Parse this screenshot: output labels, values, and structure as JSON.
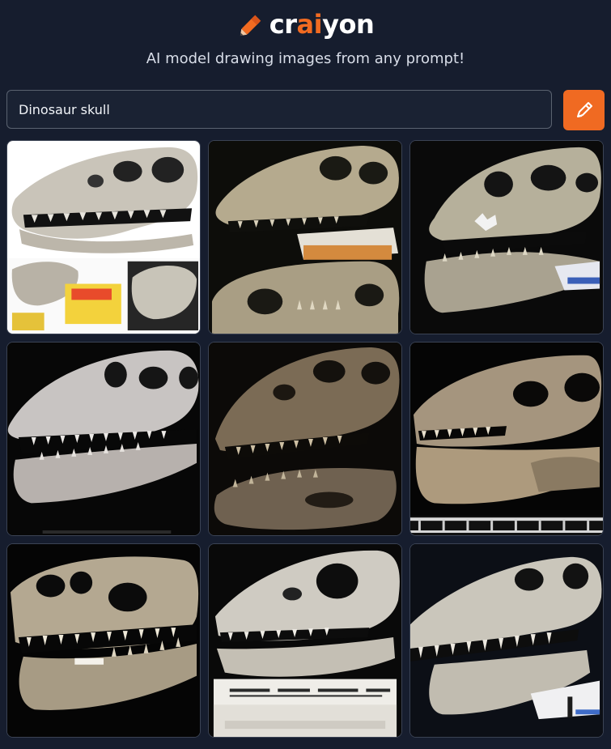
{
  "header": {
    "logo_parts": [
      "cr",
      "ai",
      "yon"
    ],
    "tagline": "AI model drawing images from any prompt!"
  },
  "search": {
    "value": "Dinosaur skull",
    "button_icon": "pencil-icon"
  },
  "brand": {
    "accent": "#f26b21",
    "background": "#161d2e"
  },
  "results": [
    {
      "id": 1,
      "bg": "#ffffff",
      "bone": "#c9c4b9"
    },
    {
      "id": 2,
      "bg": "#0d0d0a",
      "bone": "#b5aa8e"
    },
    {
      "id": 3,
      "bg": "#0a0a0a",
      "bone": "#b6b09b"
    },
    {
      "id": 4,
      "bg": "#070707",
      "bone": "#c8c4c2"
    },
    {
      "id": 5,
      "bg": "#0c0a08",
      "bone": "#7b6b55"
    },
    {
      "id": 6,
      "bg": "#050505",
      "bone": "#a5957e"
    },
    {
      "id": 7,
      "bg": "#050505",
      "bone": "#b4a891"
    },
    {
      "id": 8,
      "bg": "#090909",
      "bone": "#cfcbc2"
    },
    {
      "id": 9,
      "bg": "#0c0f16",
      "bone": "#cac6bb"
    }
  ]
}
